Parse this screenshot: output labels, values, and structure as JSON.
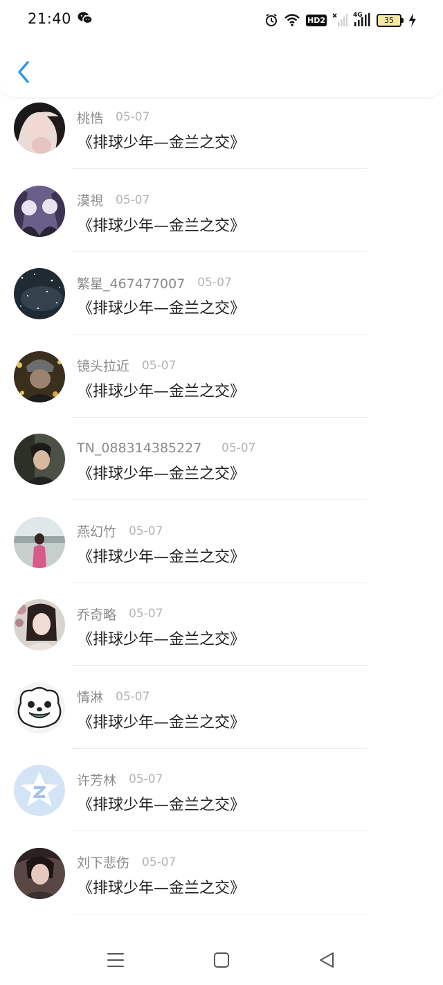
{
  "status": {
    "time": "21:40",
    "hd_label": "HD2",
    "network_label": "4G",
    "battery_level": "35"
  },
  "header": {
    "back_icon": "chevron-left-icon",
    "accent": "#2196F3"
  },
  "comments": [
    {
      "name": "桃悎",
      "date": "05-07",
      "text": "《排球少年—金兰之交》",
      "avatar": "photo-avatar-1"
    },
    {
      "name": "漠視",
      "date": "05-07",
      "text": "《排球少年—金兰之交》",
      "avatar": "photo-avatar-2"
    },
    {
      "name": "繁星_467477007",
      "date": "05-07",
      "text": "《排球少年—金兰之交》",
      "avatar": "starry-avatar"
    },
    {
      "name": "镜头拉近",
      "date": "05-07",
      "text": "《排球少年—金兰之交》",
      "avatar": "photo-avatar-4"
    },
    {
      "name": "TN_088314385227",
      "date": "05-07",
      "text": "《排球少年—金兰之交》",
      "avatar": "photo-avatar-5"
    },
    {
      "name": "燕幻竹",
      "date": "05-07",
      "text": "《排球少年—金兰之交》",
      "avatar": "photo-avatar-6"
    },
    {
      "name": "乔奇略",
      "date": "05-07",
      "text": "《排球少年—金兰之交》",
      "avatar": "photo-avatar-7"
    },
    {
      "name": "情淋",
      "date": "05-07",
      "text": "《排球少年—金兰之交》",
      "avatar": "cartoon-dog-avatar"
    },
    {
      "name": "许芳林",
      "date": "05-07",
      "text": "《排球少年—金兰之交》",
      "avatar": "default-qq-avatar"
    },
    {
      "name": "刘下悲伤",
      "date": "05-07",
      "text": "《排球少年—金兰之交》",
      "avatar": "photo-avatar-10"
    }
  ],
  "nav": {
    "menu_icon": "menu-icon",
    "home_icon": "home-icon",
    "back_icon": "back-triangle-icon"
  }
}
